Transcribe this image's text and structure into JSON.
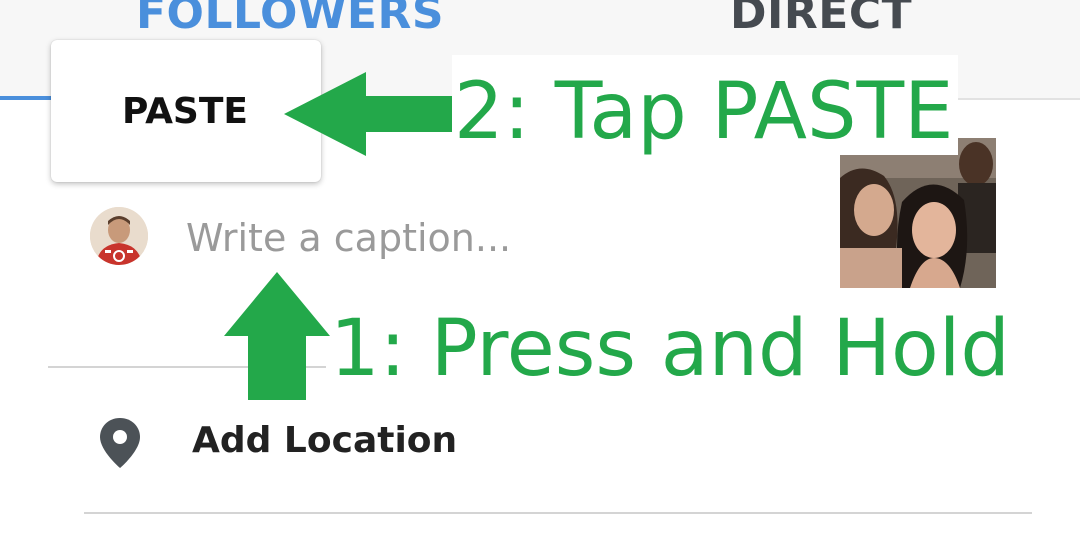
{
  "tabs": {
    "followers": "FOLLOWERS",
    "direct": "DIRECT"
  },
  "popup": {
    "paste_label": "PASTE"
  },
  "annotations": {
    "step2": "2: Tap PASTE",
    "step1": "1: Press and Hold",
    "color": "#23a84a"
  },
  "caption": {
    "placeholder": "Write a caption..."
  },
  "location": {
    "label": "Add Location"
  },
  "colors": {
    "accent": "#4a8fdc",
    "tab_inactive": "#454a50",
    "annotation_green": "#23a84a"
  },
  "icons": {
    "location": "location-pin-icon"
  }
}
